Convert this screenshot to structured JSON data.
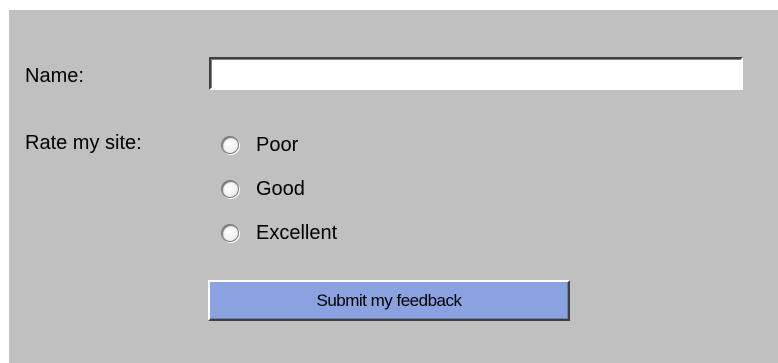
{
  "form": {
    "name_label": "Name:",
    "name_value": "",
    "rate_label": "Rate my site:",
    "options": [
      {
        "label": "Poor",
        "checked": false
      },
      {
        "label": "Good",
        "checked": false
      },
      {
        "label": "Excellent",
        "checked": false
      }
    ],
    "submit_label": "Submit my feedback"
  },
  "colors": {
    "panel_background": "#c0c0c0",
    "button_background": "#8aa2e0",
    "input_background": "#ffffff"
  }
}
